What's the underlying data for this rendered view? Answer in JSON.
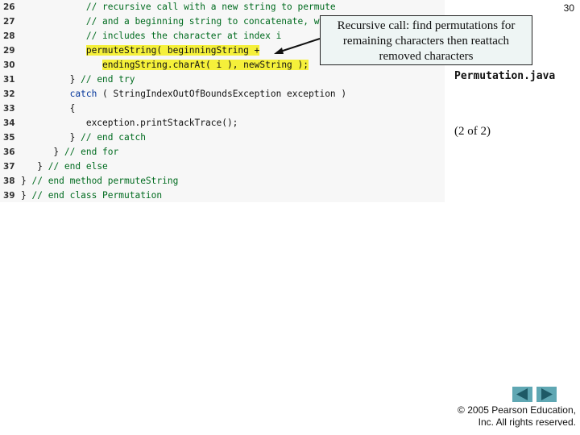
{
  "slide": {
    "page_number": "30",
    "file_name": "Permutation.java",
    "part": "(2 of 2)",
    "copyright_line1": "© 2005 Pearson Education,",
    "copyright_line2": "Inc.  All rights reserved.",
    "nav": {
      "prev_icon": "left-triangle",
      "next_icon": "right-triangle"
    }
  },
  "callout": {
    "line1": "Recursive call: find permutations for",
    "line2": "remaining characters then reattach",
    "line3": "removed characters"
  },
  "code": [
    {
      "num": "26",
      "indent": "            ",
      "segments": [
        {
          "t": "// recursive call with a new string to permute",
          "c": "cmt"
        }
      ]
    },
    {
      "num": "27",
      "indent": "            ",
      "segments": [
        {
          "t": "// and a beginning string to concatenate, which",
          "c": "cmt"
        }
      ]
    },
    {
      "num": "28",
      "indent": "            ",
      "segments": [
        {
          "t": "// includes the character at index i",
          "c": "cmt"
        }
      ]
    },
    {
      "num": "29",
      "indent": "            ",
      "segments": [
        {
          "t": "permuteString( beginningString +",
          "c": "hl"
        }
      ]
    },
    {
      "num": "30",
      "indent": "               ",
      "segments": [
        {
          "t": "endingString.charAt( i ), newString );",
          "c": "hl"
        }
      ]
    },
    {
      "num": "31",
      "indent": "         ",
      "segments": [
        {
          "t": "} ",
          "c": ""
        },
        {
          "t": "// end try",
          "c": "cmt"
        }
      ]
    },
    {
      "num": "32",
      "indent": "         ",
      "segments": [
        {
          "t": "catch",
          "c": "kw"
        },
        {
          "t": " ( StringIndexOutOfBoundsException exception )",
          "c": ""
        }
      ]
    },
    {
      "num": "33",
      "indent": "         ",
      "segments": [
        {
          "t": "{",
          "c": ""
        }
      ]
    },
    {
      "num": "34",
      "indent": "            ",
      "segments": [
        {
          "t": "exception.printStackTrace();",
          "c": ""
        }
      ]
    },
    {
      "num": "35",
      "indent": "         ",
      "segments": [
        {
          "t": "} ",
          "c": ""
        },
        {
          "t": "// end catch",
          "c": "cmt"
        }
      ]
    },
    {
      "num": "36",
      "indent": "      ",
      "segments": [
        {
          "t": "} ",
          "c": ""
        },
        {
          "t": "// end for",
          "c": "cmt"
        }
      ]
    },
    {
      "num": "37",
      "indent": "   ",
      "segments": [
        {
          "t": "} ",
          "c": ""
        },
        {
          "t": "// end else",
          "c": "cmt"
        }
      ]
    },
    {
      "num": "38",
      "indent": "",
      "segments": [
        {
          "t": "} ",
          "c": ""
        },
        {
          "t": "// end method permuteString",
          "c": "cmt"
        }
      ]
    },
    {
      "num": "39",
      "indent": "",
      "segments": [
        {
          "t": "} ",
          "c": ""
        },
        {
          "t": "// end class Permutation",
          "c": "cmt"
        }
      ]
    }
  ],
  "colors": {
    "code_bg": "#f7f7f7",
    "comment": "#006b1f",
    "keyword": "#00339a",
    "highlight": "#f5f03a",
    "callout_bg": "#eef5f4",
    "nav_button": "#5fa7b3",
    "nav_arrow": "#1e5a66"
  }
}
